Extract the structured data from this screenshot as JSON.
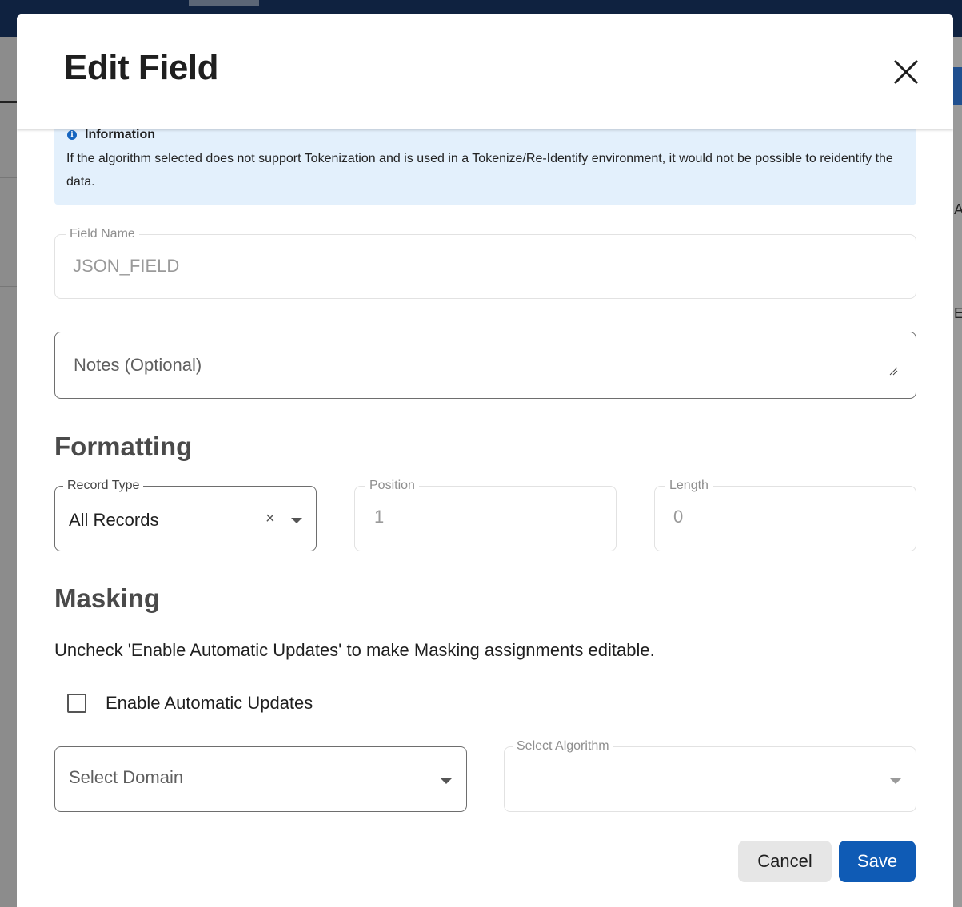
{
  "modal": {
    "title": "Edit Field",
    "close_icon": "close-icon"
  },
  "alert": {
    "icon": "info-icon",
    "title": "Information",
    "text": "If the algorithm selected does not support Tokenization and is used in a Tokenize/Re-Identify environment, it would not be possible to reidentify the data."
  },
  "field_name": {
    "label": "Field Name",
    "value": "JSON_FIELD"
  },
  "notes": {
    "placeholder": "Notes (Optional)"
  },
  "formatting": {
    "title": "Formatting",
    "record_type": {
      "label": "Record Type",
      "value": "All Records",
      "clear_symbol": "×"
    },
    "position": {
      "label": "Position",
      "value": "1"
    },
    "length": {
      "label": "Length",
      "value": "0"
    }
  },
  "masking": {
    "title": "Masking",
    "note": "Uncheck 'Enable Automatic Updates' to make Masking assignments editable.",
    "auto_updates_label": "Enable Automatic Updates",
    "auto_updates_checked": false,
    "domain_placeholder": "Select Domain",
    "algorithm_label": "Select Algorithm"
  },
  "actions": {
    "cancel_label": "Cancel",
    "save_label": "Save"
  },
  "colors": {
    "primary": "#0f5bb5",
    "alert_background": "#e3f0fc",
    "top_bar": "#0f2240"
  },
  "background": {
    "edge_chars": [
      "A",
      "E"
    ]
  }
}
